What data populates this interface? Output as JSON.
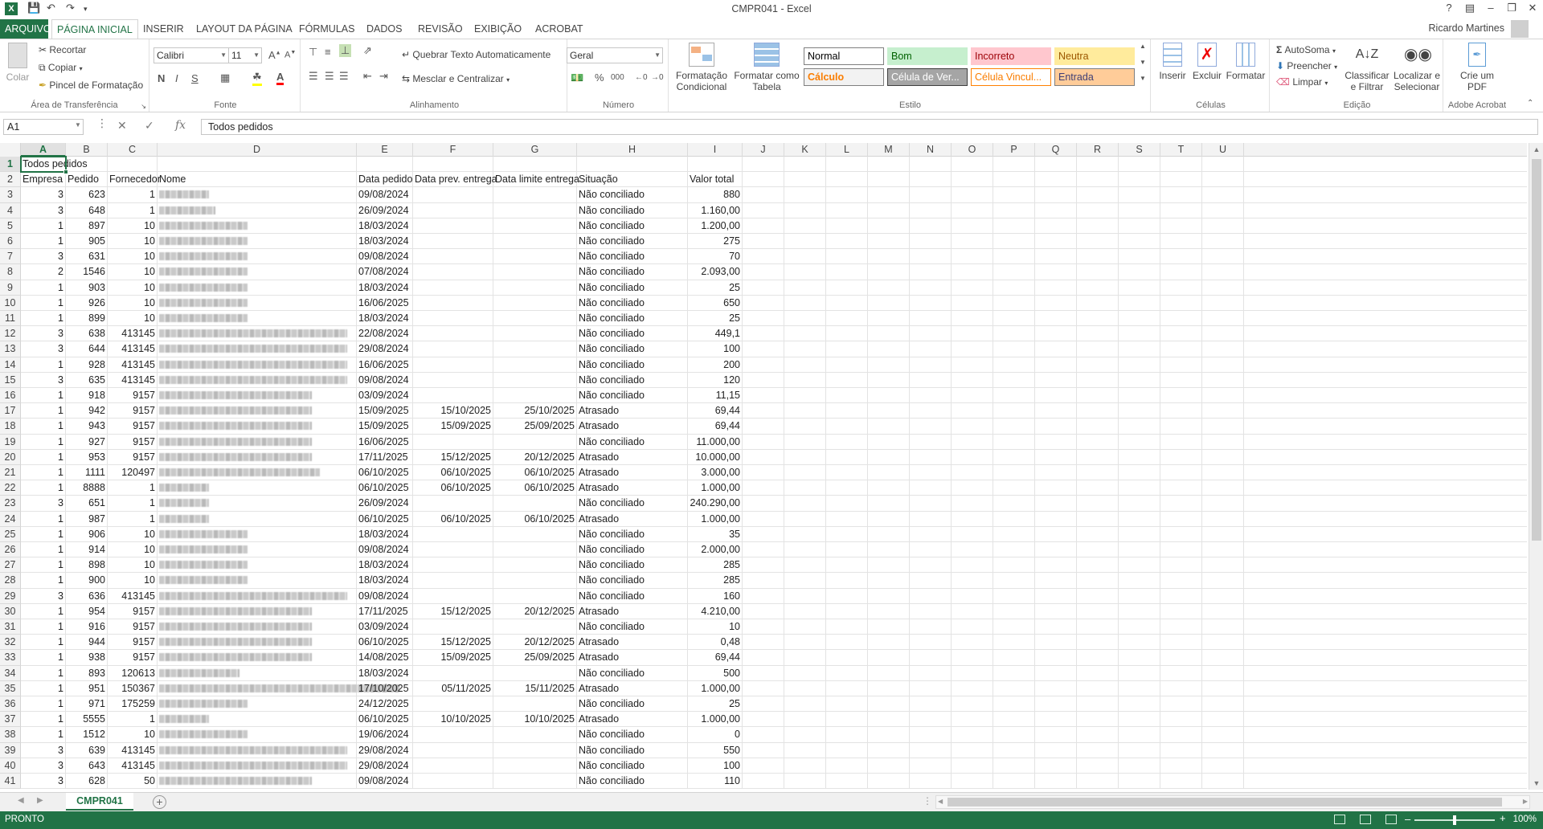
{
  "window": {
    "title": "CMPR041 - Excel",
    "help": "?",
    "user": "Ricardo Martines"
  },
  "tabs": [
    "ARQUIVO",
    "PÁGINA INICIAL",
    "INSERIR",
    "LAYOUT DA PÁGINA",
    "FÓRMULAS",
    "DADOS",
    "REVISÃO",
    "EXIBIÇÃO",
    "ACROBAT"
  ],
  "ribbon": {
    "clipboard": {
      "paste": "Colar",
      "cut": "Recortar",
      "copy": "Copiar",
      "format_painter": "Pincel de Formatação",
      "label": "Área de Transferência"
    },
    "font": {
      "name": "Calibri",
      "size": "11",
      "bold": "N",
      "italic": "I",
      "underline": "S",
      "label": "Fonte"
    },
    "alignment": {
      "wrap": "Quebrar Texto Automaticamente",
      "merge": "Mesclar e Centralizar",
      "label": "Alinhamento"
    },
    "number": {
      "format": "Geral",
      "percent": "%",
      "thousands": "000",
      "label": "Número"
    },
    "styles": {
      "conditional": "Formatação Condicional",
      "as_table": "Formatar como Tabela",
      "label": "Estilo",
      "cells": [
        {
          "text": "Normal",
          "bg": "#ffffff",
          "fg": "#000000",
          "border": "#7f7f7f"
        },
        {
          "text": "Bom",
          "bg": "#c6efce",
          "fg": "#006100",
          "border": "#c6efce"
        },
        {
          "text": "Incorreto",
          "bg": "#ffc7ce",
          "fg": "#9c0006",
          "border": "#ffc7ce"
        },
        {
          "text": "Neutra",
          "bg": "#ffeb9c",
          "fg": "#9c5700",
          "border": "#ffeb9c"
        },
        {
          "text": "Cálculo",
          "bg": "#f2f2f2",
          "fg": "#fa7d00",
          "border": "#7f7f7f"
        },
        {
          "text": "Célula de Ver...",
          "bg": "#a5a5a5",
          "fg": "#ffffff",
          "border": "#3f3f3f"
        },
        {
          "text": "Célula Vincul...",
          "bg": "#ffffff",
          "fg": "#fa7d00",
          "border": "#ff8001"
        },
        {
          "text": "Entrada",
          "bg": "#ffcc99",
          "fg": "#3f3f76",
          "border": "#7f7f7f"
        }
      ]
    },
    "cells_group": {
      "insert": "Inserir",
      "delete": "Excluir",
      "format": "Formatar",
      "label": "Células"
    },
    "editing": {
      "autosum": "AutoSoma",
      "fill": "Preencher",
      "clear": "Limpar",
      "sort": "Classificar e Filtrar",
      "find": "Localizar e Selecionar",
      "label": "Edição"
    },
    "acrobat": {
      "create_pdf": "Crie um PDF",
      "label": "Adobe Acrobat"
    }
  },
  "formula_bar": {
    "name_box": "A1",
    "fx": "fx",
    "content": "Todos pedidos"
  },
  "columns": [
    "A",
    "B",
    "C",
    "D",
    "E",
    "F",
    "G",
    "H",
    "I",
    "J",
    "K",
    "L",
    "M",
    "N",
    "O",
    "P",
    "Q",
    "R",
    "S",
    "T",
    "U"
  ],
  "sheet": {
    "title_cell": "Todos pedidos",
    "headers": [
      "Empresa",
      "Pedido",
      "Fornecedor",
      "Nome",
      "Data pedido",
      "Data prev. entrega",
      "Data limite entrega",
      "Situação",
      "Valor total"
    ],
    "rows": [
      [
        "3",
        "623",
        "1",
        "",
        "09/08/2024",
        "",
        "",
        "Não conciliado",
        "880"
      ],
      [
        "3",
        "648",
        "1",
        "",
        "26/09/2024",
        "",
        "",
        "Não conciliado",
        "1.160,00"
      ],
      [
        "1",
        "897",
        "10",
        "",
        "18/03/2024",
        "",
        "",
        "Não conciliado",
        "1.200,00"
      ],
      [
        "1",
        "905",
        "10",
        "",
        "18/03/2024",
        "",
        "",
        "Não conciliado",
        "275"
      ],
      [
        "3",
        "631",
        "10",
        "",
        "09/08/2024",
        "",
        "",
        "Não conciliado",
        "70"
      ],
      [
        "2",
        "1546",
        "10",
        "",
        "07/08/2024",
        "",
        "",
        "Não conciliado",
        "2.093,00"
      ],
      [
        "1",
        "903",
        "10",
        "",
        "18/03/2024",
        "",
        "",
        "Não conciliado",
        "25"
      ],
      [
        "1",
        "926",
        "10",
        "",
        "16/06/2025",
        "",
        "",
        "Não conciliado",
        "650"
      ],
      [
        "1",
        "899",
        "10",
        "",
        "18/03/2024",
        "",
        "",
        "Não conciliado",
        "25"
      ],
      [
        "3",
        "638",
        "413145",
        "",
        "22/08/2024",
        "",
        "",
        "Não conciliado",
        "449,1"
      ],
      [
        "3",
        "644",
        "413145",
        "",
        "29/08/2024",
        "",
        "",
        "Não conciliado",
        "100"
      ],
      [
        "1",
        "928",
        "413145",
        "",
        "16/06/2025",
        "",
        "",
        "Não conciliado",
        "200"
      ],
      [
        "3",
        "635",
        "413145",
        "",
        "09/08/2024",
        "",
        "",
        "Não conciliado",
        "120"
      ],
      [
        "1",
        "918",
        "9157",
        "",
        "03/09/2024",
        "",
        "",
        "Não conciliado",
        "11,15"
      ],
      [
        "1",
        "942",
        "9157",
        "",
        "15/09/2025",
        "15/10/2025",
        "25/10/2025",
        "Atrasado",
        "69,44"
      ],
      [
        "1",
        "943",
        "9157",
        "",
        "15/09/2025",
        "15/09/2025",
        "25/09/2025",
        "Atrasado",
        "69,44"
      ],
      [
        "1",
        "927",
        "9157",
        "",
        "16/06/2025",
        "",
        "",
        "Não conciliado",
        "11.000,00"
      ],
      [
        "1",
        "953",
        "9157",
        "",
        "17/11/2025",
        "15/12/2025",
        "20/12/2025",
        "Atrasado",
        "10.000,00"
      ],
      [
        "1",
        "1111",
        "120497",
        "",
        "06/10/2025",
        "06/10/2025",
        "06/10/2025",
        "Atrasado",
        "3.000,00"
      ],
      [
        "1",
        "8888",
        "1",
        "",
        "06/10/2025",
        "06/10/2025",
        "06/10/2025",
        "Atrasado",
        "1.000,00"
      ],
      [
        "3",
        "651",
        "1",
        "",
        "26/09/2024",
        "",
        "",
        "Não conciliado",
        "240.290,00"
      ],
      [
        "1",
        "987",
        "1",
        "",
        "06/10/2025",
        "06/10/2025",
        "06/10/2025",
        "Atrasado",
        "1.000,00"
      ],
      [
        "1",
        "906",
        "10",
        "",
        "18/03/2024",
        "",
        "",
        "Não conciliado",
        "35"
      ],
      [
        "1",
        "914",
        "10",
        "",
        "09/08/2024",
        "",
        "",
        "Não conciliado",
        "2.000,00"
      ],
      [
        "1",
        "898",
        "10",
        "",
        "18/03/2024",
        "",
        "",
        "Não conciliado",
        "285"
      ],
      [
        "1",
        "900",
        "10",
        "",
        "18/03/2024",
        "",
        "",
        "Não conciliado",
        "285"
      ],
      [
        "3",
        "636",
        "413145",
        "",
        "09/08/2024",
        "",
        "",
        "Não conciliado",
        "160"
      ],
      [
        "1",
        "954",
        "9157",
        "",
        "17/11/2025",
        "15/12/2025",
        "20/12/2025",
        "Atrasado",
        "4.210,00"
      ],
      [
        "1",
        "916",
        "9157",
        "",
        "03/09/2024",
        "",
        "",
        "Não conciliado",
        "10"
      ],
      [
        "1",
        "944",
        "9157",
        "",
        "06/10/2025",
        "15/12/2025",
        "20/12/2025",
        "Atrasado",
        "0,48"
      ],
      [
        "1",
        "938",
        "9157",
        "",
        "14/08/2025",
        "15/09/2025",
        "25/09/2025",
        "Atrasado",
        "69,44"
      ],
      [
        "1",
        "893",
        "120613",
        "",
        "18/03/2024",
        "",
        "",
        "Não conciliado",
        "500"
      ],
      [
        "1",
        "951",
        "150367",
        "",
        "17/10/2025",
        "05/11/2025",
        "15/11/2025",
        "Atrasado",
        "1.000,00"
      ],
      [
        "1",
        "971",
        "175259",
        "",
        "24/12/2025",
        "",
        "",
        "Não conciliado",
        "25"
      ],
      [
        "1",
        "5555",
        "1",
        "",
        "06/10/2025",
        "10/10/2025",
        "10/10/2025",
        "Atrasado",
        "1.000,00"
      ],
      [
        "1",
        "1512",
        "10",
        "",
        "19/06/2024",
        "",
        "",
        "Não conciliado",
        "0"
      ],
      [
        "3",
        "639",
        "413145",
        "",
        "29/08/2024",
        "",
        "",
        "Não conciliado",
        "550"
      ],
      [
        "3",
        "643",
        "413145",
        "",
        "29/08/2024",
        "",
        "",
        "Não conciliado",
        "100"
      ],
      [
        "3",
        "628",
        "50",
        "",
        "09/08/2024",
        "",
        "",
        "Não conciliado",
        "110"
      ]
    ]
  },
  "sheet_tab": "CMPR041",
  "add_sheet": "+",
  "status": {
    "ready": "PRONTO",
    "zoom": "100%"
  }
}
